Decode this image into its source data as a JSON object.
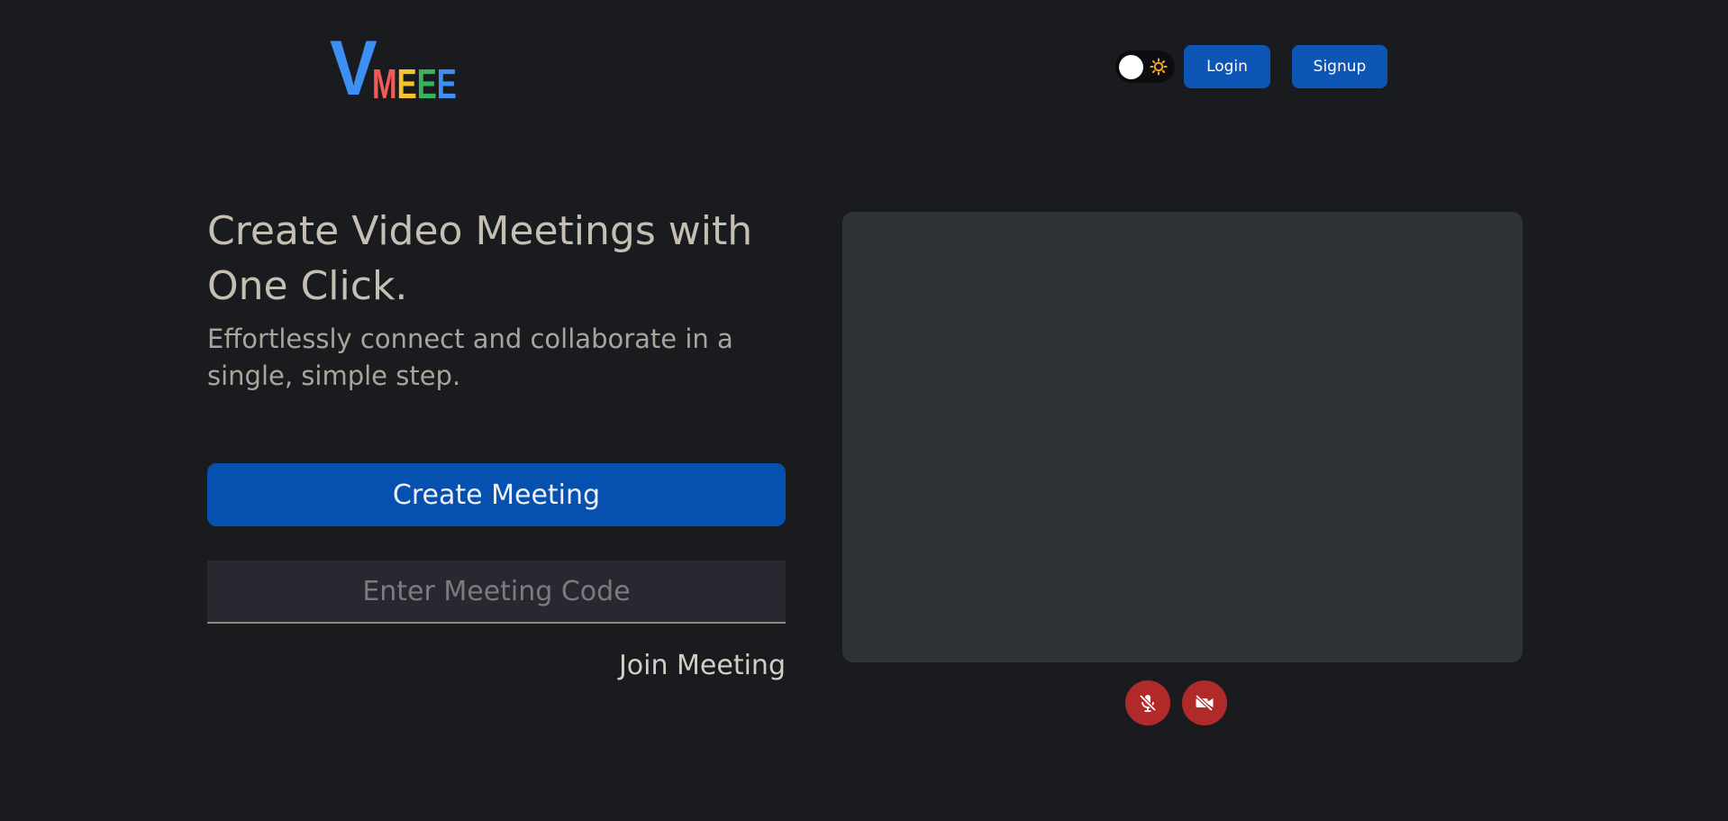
{
  "header": {
    "logo": {
      "v": "V",
      "letters": [
        {
          "char": "M",
          "color": "#f05a57"
        },
        {
          "char": "E",
          "color": "#f2c230"
        },
        {
          "char": "E",
          "color": "#35b559"
        },
        {
          "char": "E",
          "color": "#3b8ff5"
        }
      ],
      "v_color": "#3b8ff5"
    },
    "theme_toggle_icon": "sun-icon",
    "login_label": "Login",
    "signup_label": "Signup"
  },
  "hero": {
    "title": "Create Video Meetings with One Click.",
    "subtitle": "Effortlessly connect and collaborate in a single, simple step.",
    "create_label": "Create Meeting",
    "code_placeholder": "Enter Meeting Code",
    "join_label": "Join Meeting"
  },
  "preview": {
    "mic_icon": "mic-off-icon",
    "camera_icon": "video-off-icon"
  },
  "colors": {
    "background": "#1a1b1e",
    "primary": "#0650b0",
    "danger": "#b02a2a",
    "preview_bg": "#303336",
    "sun": "#f5a623"
  }
}
